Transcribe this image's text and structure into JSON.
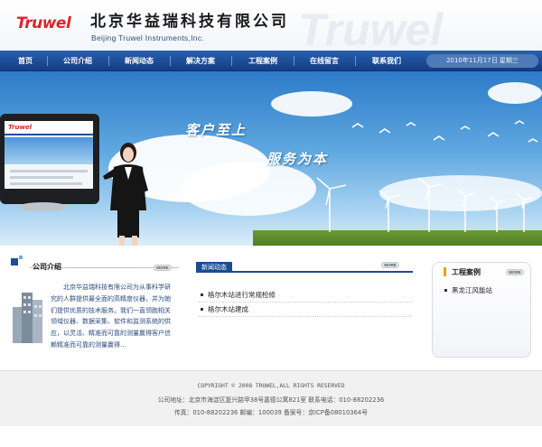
{
  "header": {
    "logo_text": "Truwel",
    "company_cn": "北京华益瑞科技有限公司",
    "company_en": "Beijing Truwel Instruments,Inc.",
    "watermark_text": "Truwel"
  },
  "nav": {
    "items": [
      {
        "label": "首页"
      },
      {
        "label": "公司介绍"
      },
      {
        "label": "新闻动态"
      },
      {
        "label": "解决方案"
      },
      {
        "label": "工程案例"
      },
      {
        "label": "在线留言"
      },
      {
        "label": "联系我们"
      }
    ],
    "date": "2010年11月17日 星期三"
  },
  "banner": {
    "slogan_1": "客户至上",
    "slogan_2": "服务为本",
    "screen_logo": "Truwel"
  },
  "about": {
    "title": "公司介绍",
    "more_label": "MORE",
    "text": "北京华益瑞科技有限公司为从事科学研究的人群提供最全面的高精度仪器，并为她们提供优质的技术服务。我们一直领跑相关领域仪器、数据采集、软件和监测系统的供应，以灵活、精准而可靠的测量赢得客户信赖精准而可靠的测量赢得..."
  },
  "news": {
    "title": "新闻动态",
    "more_label": "MORE",
    "items": [
      {
        "label": "格尔木站进行常规检修"
      },
      {
        "label": "格尔木站建成"
      }
    ]
  },
  "cases": {
    "title": "工程案例",
    "more_label": "MORE",
    "items": [
      {
        "label": "黑龙江风能站"
      }
    ]
  },
  "footer": {
    "copyright": "COPYRIGHT © 2008 TRUWEL,ALL RIGHTS RESERVED",
    "address": "公司地址：北京市海淀区复兴路甲38号嘉德公寓821室  联系电话：010-88202236",
    "contact": "传真：010-88202236   邮编：100039  备案号：京ICP备08010364号"
  },
  "colors": {
    "brand_red": "#d8262b",
    "nav_blue": "#1c4c93",
    "text_blue": "#2b4c7e"
  }
}
